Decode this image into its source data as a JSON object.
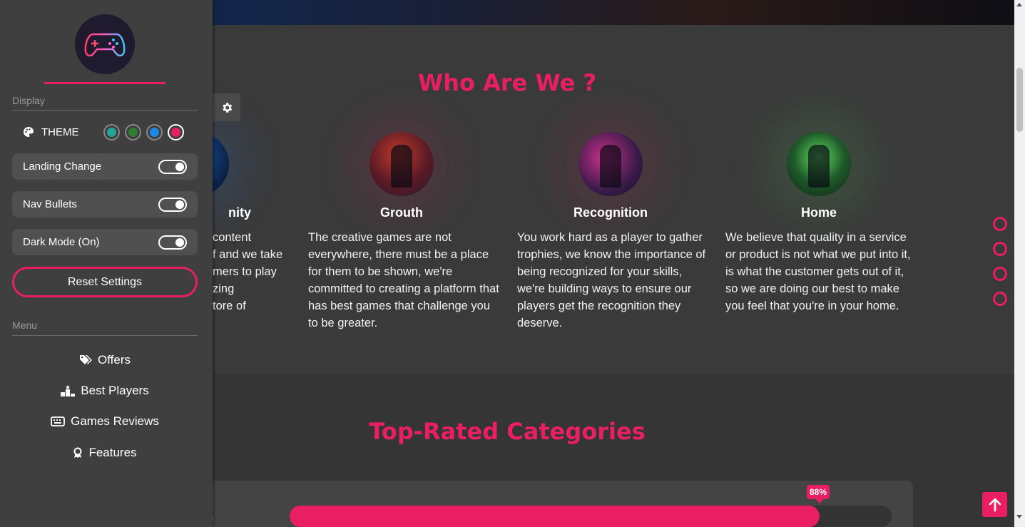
{
  "sidebar": {
    "display_label": "Display",
    "theme_label": "THEME",
    "theme_colors": [
      "#26a69a",
      "#2e7d32",
      "#1e88e5",
      "#e91e63"
    ],
    "options": [
      {
        "label": "Landing Change",
        "on": true
      },
      {
        "label": "Nav Bullets",
        "on": true
      },
      {
        "label": "Dark Mode (On)",
        "on": true
      }
    ],
    "reset_label": "Reset Settings",
    "menu_label": "Menu",
    "menu": [
      {
        "label": "Offers",
        "icon": "tags-icon"
      },
      {
        "label": "Best Players",
        "icon": "podium-icon"
      },
      {
        "label": "Games Reviews",
        "icon": "keyboard-icon"
      },
      {
        "label": "Features",
        "icon": "award-icon"
      }
    ]
  },
  "about": {
    "title": "Who Are We ?",
    "cards": [
      {
        "title": "nity",
        "text": "content\nf and we take\nmers to play\nzing\ntore of"
      },
      {
        "title": "Grouth",
        "text": "The creative games are not everywhere, there must be a place for them to be shown, we're committed to creating a platform that has best games that challenge you to be greater."
      },
      {
        "title": "Recognition",
        "text": "You work hard as a player to gather trophies, we know the importance of being recognized for your skills, we're building ways to ensure our players get the recognition they deserve."
      },
      {
        "title": "Home",
        "text": "We believe that quality in a service or product is not what we put into it, is what the customer gets out of it, so we are doing our best to make you feel that you're in your home."
      }
    ]
  },
  "categories": {
    "title": "Top-Rated Categories",
    "skill_label": "n",
    "progress_label": "88%",
    "progress": 88
  },
  "colors": {
    "accent": "#e91e63"
  }
}
